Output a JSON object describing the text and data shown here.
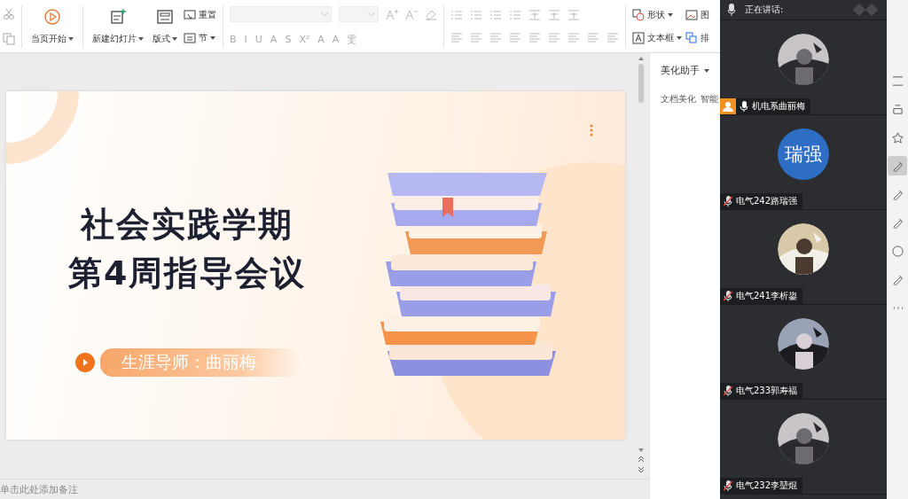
{
  "ribbon": {
    "play_label": "当页开始",
    "new_slide_label": "新建幻灯片",
    "layout_label": "版式",
    "reset_label": "重置",
    "section_label": "节",
    "format_glyphs": [
      "B",
      "I",
      "U",
      "A",
      "S",
      "X²",
      "A",
      "A",
      "雯"
    ],
    "shape_label": "形状",
    "picture_label": "图",
    "textbox_label": "文本框",
    "arrange_label": "排"
  },
  "slide": {
    "title_lines": [
      "社会实践学期",
      "第4周指导会议"
    ],
    "subtitle": "生涯导师：曲丽梅"
  },
  "notes": {
    "placeholder": "单击此处添加备注"
  },
  "side_pane": {
    "title": "美化助手",
    "tabs": [
      {
        "label": "文档美化",
        "selected": false
      },
      {
        "label": "智能",
        "selected": false
      }
    ]
  },
  "meeting": {
    "speaking_label": "正在讲话:",
    "participants": [
      {
        "name": "机电系曲丽梅",
        "muted": false,
        "host": true
      },
      {
        "name": "电气242路瑞强",
        "muted": true,
        "host": false,
        "avatar": {
          "kind": "text",
          "text": "瑞强"
        }
      },
      {
        "name": "电气241李析鋆",
        "muted": true,
        "host": false
      },
      {
        "name": "电气233郭寿福",
        "muted": true,
        "host": false
      },
      {
        "name": "电气232李堃焜",
        "muted": true,
        "host": false
      }
    ]
  },
  "right_tools": [
    {
      "selected": false
    },
    {
      "selected": false
    },
    {
      "selected": false
    },
    {
      "selected": true
    },
    {
      "selected": false
    },
    {
      "selected": false
    },
    {
      "selected": false
    },
    {
      "selected": false
    },
    {
      "selected": false
    }
  ]
}
